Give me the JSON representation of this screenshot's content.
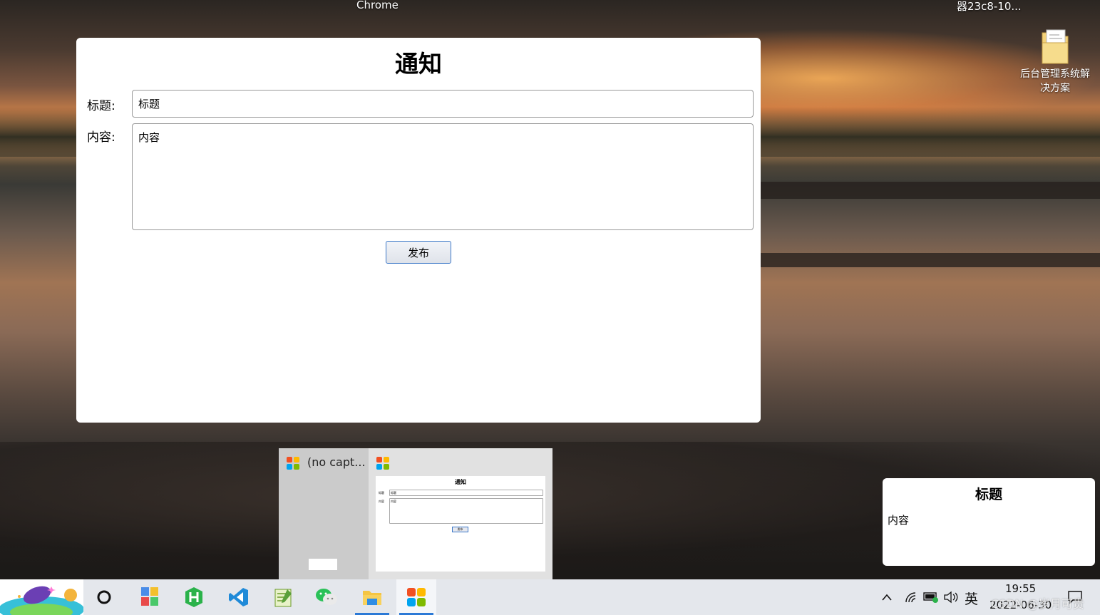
{
  "desktop": {
    "bg_window_title": "Chrome",
    "bg_right_title": "器23c8-10...",
    "icon_label": "后台管理系统解决方案"
  },
  "window": {
    "title": "通知",
    "title_label": "标题:",
    "title_value": "标题",
    "content_label": "内容:",
    "content_value": "内容",
    "publish_button": "发布"
  },
  "switcher": {
    "item1_title": "(no capt...",
    "thumb_title": "通知",
    "thumb_title_label": "标题",
    "thumb_title_value": "标题",
    "thumb_content_label": "内容",
    "thumb_content_value": "内容",
    "thumb_button": "发布"
  },
  "notification": {
    "title": "标题",
    "body": "内容"
  },
  "taskbar": {
    "icons": [
      "weather-widget-icon",
      "cortana-icon",
      "app-icon",
      "hbuilder-icon",
      "vscode-icon",
      "notepad-icon",
      "wechat-icon",
      "file-explorer-icon",
      "app-running-icon"
    ],
    "ime": "英",
    "time": "19:55",
    "date": "2022-06-30"
  },
  "watermark": "CSDN @岁月可贵",
  "colors": {
    "accent": "#2b79d6",
    "app_icon": [
      "#f25022",
      "#7fba00",
      "#00a4ef",
      "#ffb900"
    ]
  }
}
